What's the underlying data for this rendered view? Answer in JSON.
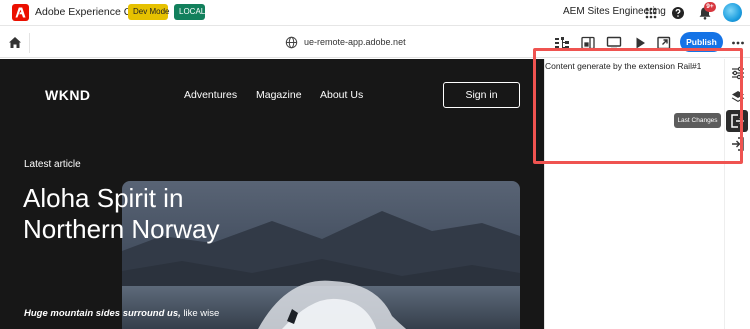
{
  "shell": {
    "title": "Adobe Experience Cloud",
    "badges": [
      "Dev Mode",
      "LOCAL"
    ],
    "org_name": "AEM Sites Engineering",
    "notification_count": "9+",
    "icons": [
      "adobe-logo-icon",
      "apps-grid-icon",
      "help-icon",
      "bell-icon",
      "avatar"
    ]
  },
  "toolbar": {
    "url": "ue-remote-app.adobe.net",
    "publish_label": "Publish",
    "icons": [
      "home-icon",
      "globe-icon",
      "content-tree-icon",
      "properties-icon",
      "desktop-icon",
      "preview-play-icon",
      "open-external-icon",
      "more-icon"
    ],
    "accent_color": "#1473e6"
  },
  "site": {
    "logo": "WKND",
    "nav": [
      "Adventures",
      "Magazine",
      "About Us"
    ],
    "signin_label": "Sign in",
    "latest_label": "Latest article",
    "article_title": "Aloha Spirit in Northern Norway",
    "teaser_bold": "Huge mountain sides surround us,",
    "teaser_rest": " like wise"
  },
  "rail": {
    "content": "Content generate by the extension Rail#1",
    "tooltip": "Last Changes",
    "icons": [
      "sliders-icon",
      "layers-icon",
      "sign-out-icon",
      "sign-in-icon"
    ],
    "highlight_color": "#ef5350"
  }
}
